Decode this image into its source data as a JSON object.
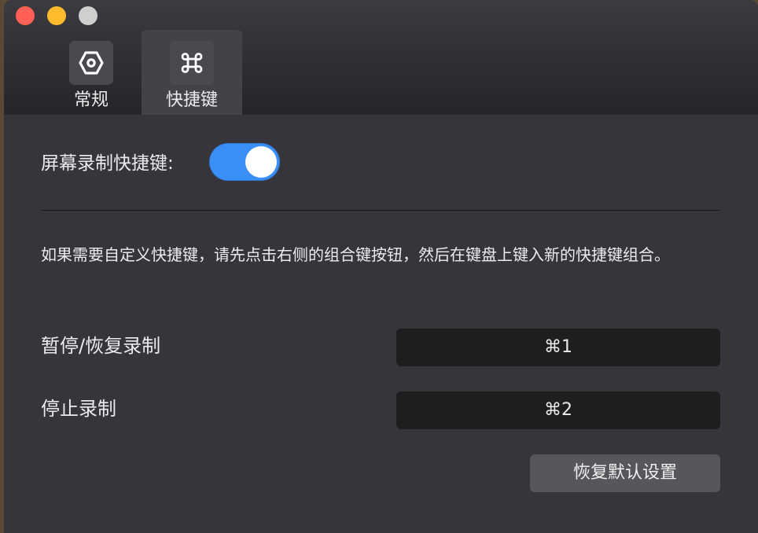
{
  "window": {
    "controls": {
      "close_color": "#fe5f57",
      "minimize_color": "#febb2e",
      "zoom_color": "#cfcfcf"
    },
    "tabs": [
      {
        "label": "常规",
        "icon": "gear-hexagon-icon",
        "selected": false
      },
      {
        "label": "快捷键",
        "icon": "command-key-icon",
        "selected": true
      }
    ]
  },
  "shortcuts": {
    "record_label": "屏幕录制快捷键:",
    "record_enabled": true,
    "description": "如果需要自定义快捷键，请先点击右侧的组合键按钮，然后在键盘上键入新的快捷键组合。",
    "rows": [
      {
        "label": "暂停/恢复录制",
        "keys": "⌘1"
      },
      {
        "label": "停止录制",
        "keys": "⌘2"
      }
    ],
    "reset_label": "恢复默认设置"
  },
  "colors": {
    "accent": "#3a8ff6",
    "background": "#36353c"
  }
}
